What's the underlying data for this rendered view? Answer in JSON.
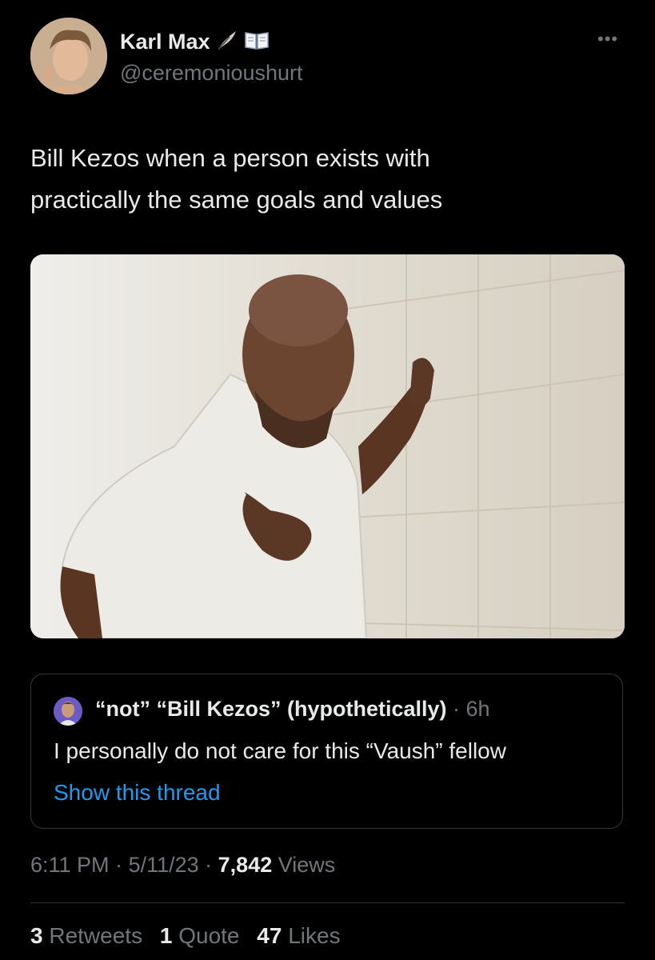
{
  "author": {
    "name": "Karl Max",
    "handle": "@ceremonioushurt",
    "badge_icons": [
      "feather-icon",
      "open-book-icon"
    ]
  },
  "more_label": "•••",
  "tweet": {
    "text_line1": "Bill Kezos when a person exists with",
    "text_line2": "practically the same goals and values"
  },
  "quoted": {
    "name": "“not” “Bill Kezos” (hypothetically)",
    "separator": " · ",
    "time": "6h",
    "text": "I personally do not care for this “Vaush” fellow",
    "link": "Show this thread"
  },
  "meta": {
    "time": "6:11 PM",
    "sep1": " · ",
    "date": "5/11/23",
    "sep2": " · ",
    "views_count": "7,842",
    "views_label": " Views"
  },
  "stats": {
    "retweets_count": "3",
    "retweets_label": " Retweets",
    "quotes_count": "1",
    "quotes_label": " Quote",
    "likes_count": "47",
    "likes_label": " Likes"
  },
  "colors": {
    "background": "#000000",
    "primary_text": "#e7e9ea",
    "secondary_text": "#71767b",
    "link": "#1d9bf0",
    "border": "#333639"
  }
}
